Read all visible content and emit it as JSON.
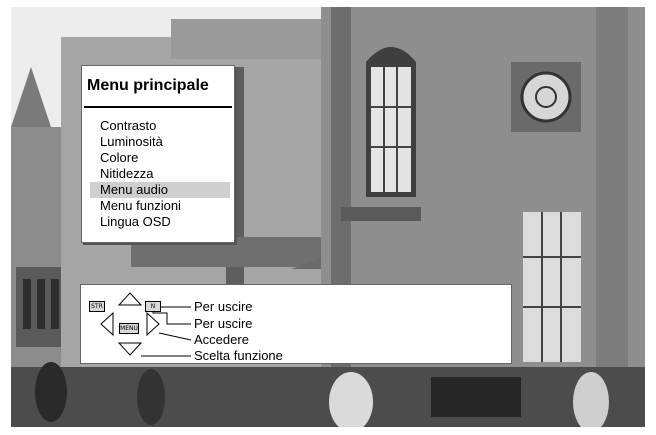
{
  "menu": {
    "title": "Menu principale",
    "items": [
      {
        "label": "Contrasto",
        "selected": false
      },
      {
        "label": "Luminosità",
        "selected": false
      },
      {
        "label": "Colore",
        "selected": false
      },
      {
        "label": "Nitidezza",
        "selected": false
      },
      {
        "label": "Menu audio",
        "selected": true
      },
      {
        "label": "Menu funzioni",
        "selected": false
      },
      {
        "label": "Lingua OSD",
        "selected": false
      }
    ]
  },
  "help": {
    "keys": {
      "str": "STR",
      "n": "N",
      "menu": "MENU"
    },
    "labels": [
      "Per uscire",
      "Per uscire",
      "Accedere",
      "Scelta funzione"
    ]
  },
  "colors": {
    "selection": "#cfcfcf",
    "panel": "#ffffff"
  }
}
